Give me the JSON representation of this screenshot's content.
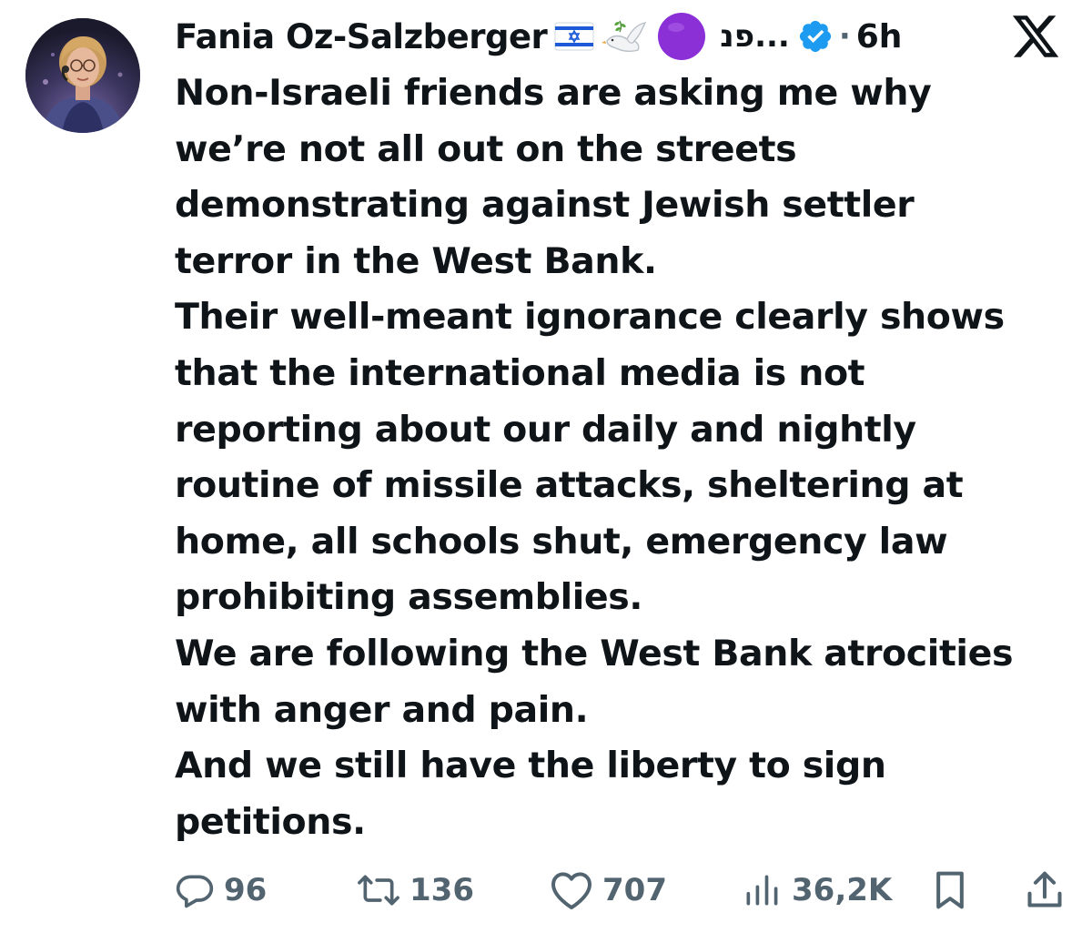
{
  "author": {
    "name": "Fania Oz-Salzberger",
    "handle": "פנ...",
    "time": "6h",
    "separator": "·",
    "avatar": "avatar-photo",
    "badge_emojis": [
      "israel-flag",
      "dove-with-olive-branch",
      "purple-circle"
    ],
    "verified_icon": "verified-badge-icon",
    "verified_color": "#1d9bf0"
  },
  "platform_logo": "x-logo",
  "tweet": {
    "lines": [
      "Non-Israeli friends are asking me why",
      "we’re not all out on the streets",
      "demonstrating against Jewish settler",
      "terror in the West Bank.",
      "Their well-meant ignorance clearly shows",
      "that the international media is not",
      "reporting about our daily and nightly",
      "routine of missile attacks, sheltering at",
      "home, all schools shut, emergency law",
      "prohibiting assemblies.",
      "We are following the West Bank atrocities",
      "with anger and pain.",
      "And we still have the liberty to sign",
      "petitions."
    ]
  },
  "actions": {
    "replies": {
      "icon": "reply-icon",
      "count": "96"
    },
    "reposts": {
      "icon": "repost-icon",
      "count": "136"
    },
    "likes": {
      "icon": "heart-icon",
      "count": "707"
    },
    "views": {
      "icon": "views-icon",
      "count": "36,2K"
    },
    "bookmark": {
      "icon": "bookmark-icon"
    },
    "share": {
      "icon": "share-icon"
    }
  },
  "colors": {
    "text": "#0f1419",
    "secondary": "#536471",
    "accent": "#1d9bf0",
    "purple": "#8b2fd6"
  }
}
